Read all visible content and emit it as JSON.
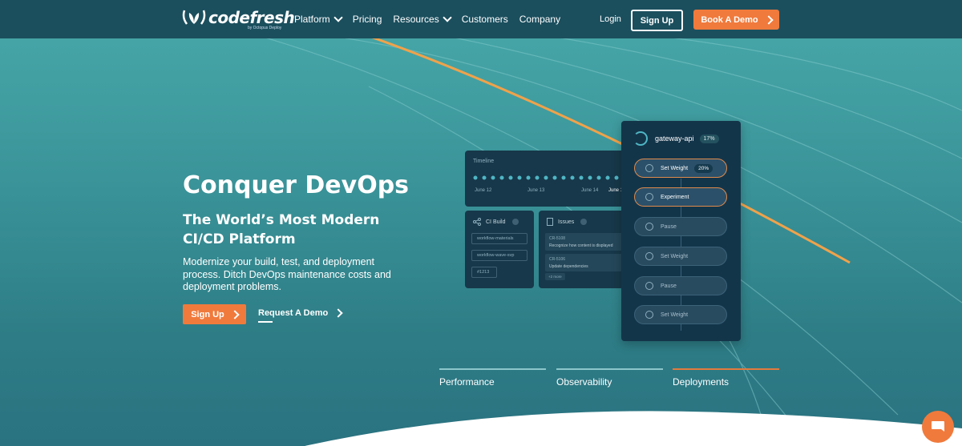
{
  "nav": {
    "logo_text": "codefresh",
    "logo_sub": "by Octopus Deploy",
    "items": [
      {
        "label": "Platform",
        "dropdown": true
      },
      {
        "label": "Pricing",
        "dropdown": false
      },
      {
        "label": "Resources",
        "dropdown": true
      },
      {
        "label": "Customers",
        "dropdown": false
      },
      {
        "label": "Company",
        "dropdown": false
      }
    ],
    "login": "Login",
    "signup": "Sign Up",
    "demo": "Book A Demo"
  },
  "hero": {
    "title": "Conquer DevOps",
    "subtitle": "The World’s Most Modern CI/CD Platform",
    "description": "Modernize your build, test, and deployment process. Ditch DevOps maintenance costs and deployment problems.",
    "signup": "Sign Up",
    "request_demo": "Request A Demo"
  },
  "illustration": {
    "timeline": {
      "title": "Timeline",
      "dates": [
        "June 12",
        "June 13",
        "June 14",
        "June 1"
      ]
    },
    "ci_build": {
      "title": "CI Build",
      "items": [
        "workflow-materials",
        "workflow-wave-svp",
        "#1213"
      ]
    },
    "issues": {
      "title": "Issues",
      "items": [
        {
          "id": "CR-5108",
          "text": "Recognize how content is displayed"
        },
        {
          "id": "CR-5106",
          "text": "Update dependencies"
        }
      ],
      "tag": "+2 more"
    },
    "rollout": {
      "service": "gateway-api",
      "percent": "17%",
      "steps": [
        {
          "label": "Set Weight",
          "value": "20%",
          "active": true,
          "icon": "scale-icon"
        },
        {
          "label": "Experiment",
          "value": "",
          "active": true,
          "icon": "flask-icon"
        },
        {
          "label": "Pause",
          "value": "",
          "active": false,
          "icon": "pause-icon"
        },
        {
          "label": "Set Weight",
          "value": "",
          "active": false,
          "icon": "scale-icon"
        },
        {
          "label": "Pause",
          "value": "",
          "active": false,
          "icon": "pause-icon"
        },
        {
          "label": "Set Weight",
          "value": "",
          "active": false,
          "icon": "scale-icon"
        }
      ]
    }
  },
  "tabs": [
    {
      "label": "Performance",
      "active": false
    },
    {
      "label": "Observability",
      "active": false
    },
    {
      "label": "Deployments",
      "active": true
    }
  ],
  "colors": {
    "accent": "#f07a3c",
    "nav_bg": "#1b4f5e",
    "hero_bg": "#3a9499",
    "panel_bg": "#17384a"
  },
  "chat_icon": "chat-bubble-icon"
}
